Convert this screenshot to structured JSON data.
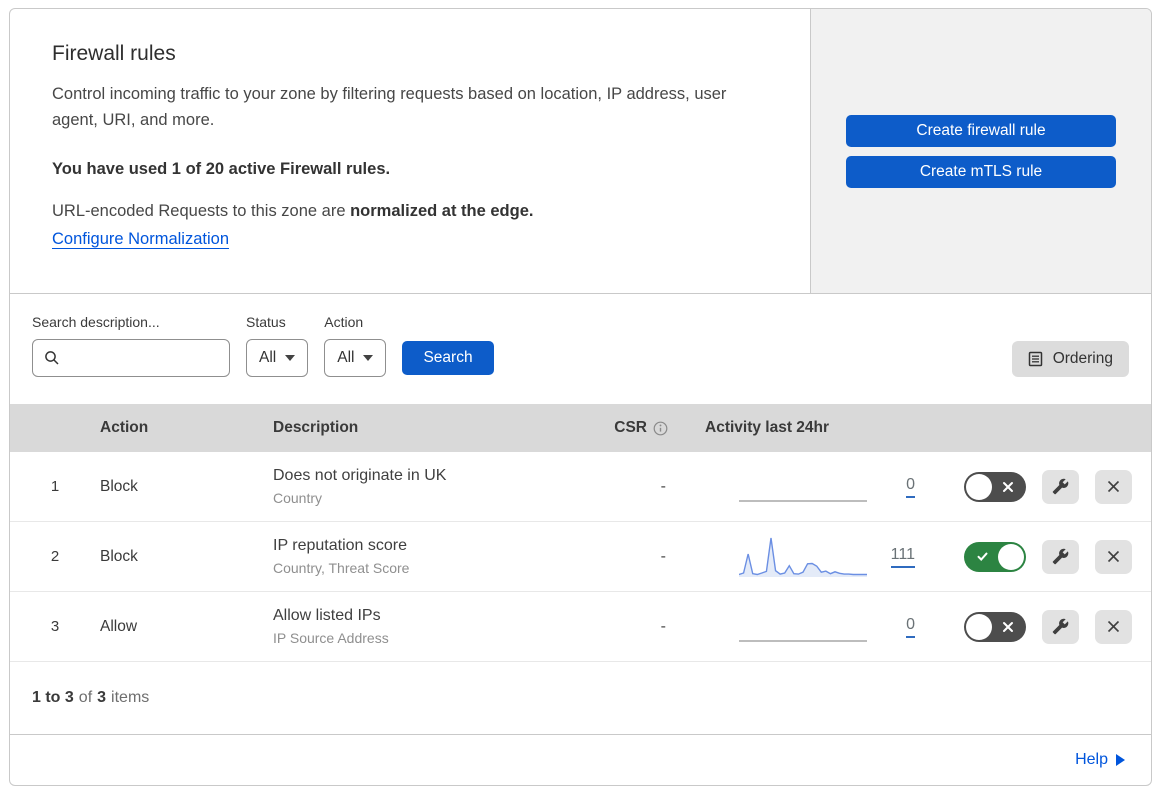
{
  "header": {
    "title": "Firewall rules",
    "description": "Control incoming traffic to your zone by filtering requests based on location, IP address, user agent, URI, and more.",
    "usage_bold": "You have used 1 of 20 active Firewall rules.",
    "normalization_text": "URL-encoded Requests to this zone are ",
    "normalization_bold": "normalized at the edge.",
    "normalization_link": "Configure Normalization"
  },
  "actions_panel": {
    "create_firewall_rule_label": "Create firewall rule",
    "create_mtls_rule_label": "Create mTLS rule"
  },
  "filters": {
    "search_label": "Search description...",
    "search_value": "",
    "status_label": "Status",
    "status_value": "All",
    "action_label": "Action",
    "action_value": "All",
    "search_button_label": "Search",
    "ordering_button_label": "Ordering"
  },
  "table": {
    "columns": {
      "action": "Action",
      "description": "Description",
      "csr": "CSR",
      "activity": "Activity last 24hr"
    },
    "rows": [
      {
        "priority": "1",
        "action": "Block",
        "description": "Does not originate in UK",
        "fields": "Country",
        "csr": "-",
        "activity_count": "0",
        "enabled": false,
        "sparkline": "flat",
        "sparkline_values": []
      },
      {
        "priority": "2",
        "action": "Block",
        "description": "IP reputation score",
        "fields": "Country, Threat Score",
        "csr": "-",
        "activity_count": "111",
        "enabled": true,
        "sparkline": "active",
        "sparkline_values": [
          4,
          8,
          58,
          6,
          4,
          8,
          12,
          100,
          14,
          5,
          8,
          27,
          6,
          5,
          10,
          32,
          33,
          26,
          10,
          13,
          6,
          11,
          7,
          5,
          5,
          4,
          4,
          4,
          4
        ]
      },
      {
        "priority": "3",
        "action": "Allow",
        "description": "Allow listed IPs",
        "fields": "IP Source Address",
        "csr": "-",
        "activity_count": "0",
        "enabled": false,
        "sparkline": "flat",
        "sparkline_values": []
      }
    ]
  },
  "footer": {
    "range": "1 to 3",
    "of": "of",
    "total": "3",
    "items": "items"
  },
  "help": {
    "label": "Help"
  },
  "colors": {
    "primary_button": "#0d5cc9",
    "link": "#0055dc",
    "toggle_on": "#2c8442",
    "toggle_off": "#4d4d4d",
    "table_header_bg": "#d9d9d9",
    "side_panel_bg": "#f1f1f1",
    "sparkline_stroke": "#6b8fe3",
    "sparkline_fill": "#e4ebf8"
  }
}
